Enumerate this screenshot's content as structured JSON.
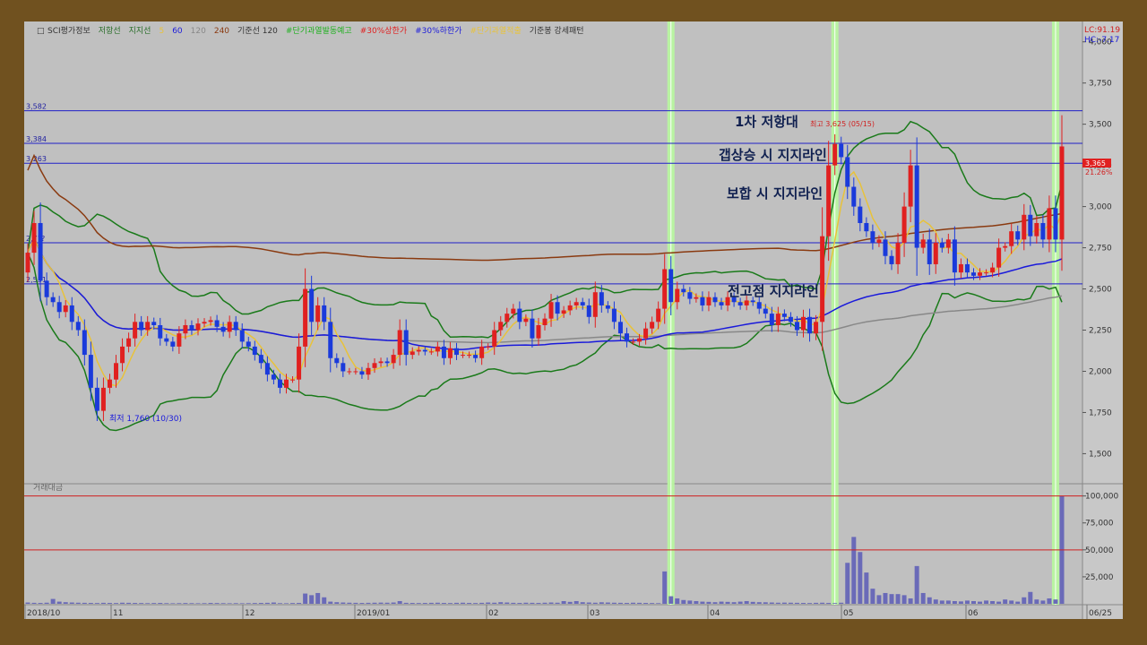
{
  "legend": {
    "items": [
      {
        "label": "SCI평가정보",
        "color": "#333333"
      },
      {
        "label": "저항선",
        "color": "#2a6e2a"
      },
      {
        "label": "지지선",
        "color": "#2a6e2a"
      },
      {
        "label": "5",
        "color": "#e8c23a"
      },
      {
        "label": "60",
        "color": "#1a1adb"
      },
      {
        "label": "120",
        "color": "#888888"
      },
      {
        "label": "240",
        "color": "#8a3a10"
      },
      {
        "label": "기준선 120",
        "color": "#333333"
      },
      {
        "label": "#단기과열발동예고",
        "color": "#20b020"
      },
      {
        "label": "#30%상한가",
        "color": "#e02020"
      },
      {
        "label": "#30%하한가",
        "color": "#1a1adb"
      },
      {
        "label": "#단기과열적출",
        "color": "#e8c23a"
      },
      {
        "label": "기준봉 강세패턴",
        "color": "#333333"
      }
    ]
  },
  "top_right": {
    "lc": "LC:91.19",
    "hc": "HC:-7.17"
  },
  "price_tag": {
    "value": "3,365",
    "change": "21.26%"
  },
  "volume_label": "거래대금",
  "annotations": {
    "resistance1": "1차 저항대",
    "gap_support": "갭상승 시 지지라인",
    "box_support": "보합 시 지지라인",
    "prev_high_support": "전고점 지지라인",
    "high_label": "최고 3,625 (05/15)",
    "low_label": "최저 1,760 (10/30)"
  },
  "chart_data": {
    "type": "candlestick",
    "price_axis": {
      "ylim": [
        1350,
        4080
      ],
      "ticks": [
        "4,000",
        "3,750",
        "3,500",
        "3,250",
        "3,000",
        "2,750",
        "2,500",
        "2,250",
        "2,000",
        "1,750",
        "1,500"
      ],
      "tick_values": [
        4000,
        3750,
        3500,
        3250,
        3000,
        2750,
        2500,
        2250,
        2000,
        1750,
        1500
      ]
    },
    "volume_axis": {
      "ylim": [
        0,
        108000
      ],
      "ticks": [
        "100,000",
        "75,000",
        "50,000",
        "25,000"
      ],
      "tick_values": [
        100000,
        75000,
        50000,
        25000
      ]
    },
    "x_labels": [
      "2018/10",
      "11",
      "12",
      "2019/01",
      "02",
      "03",
      "04",
      "05",
      "06",
      "06/25"
    ],
    "horizontal_levels": [
      {
        "label": "3,582",
        "value": 3582
      },
      {
        "label": "3,384",
        "value": 3384
      },
      {
        "label": "3,263",
        "value": 3263
      },
      {
        "label": "2,7??",
        "value": 2780
      },
      {
        "label": "2,531",
        "value": 2531
      }
    ],
    "candle_series": {
      "open": [
        2600,
        2720,
        2900,
        2550,
        2450,
        2420,
        2360,
        2400,
        2300,
        2250,
        2100,
        1900,
        1760,
        1900,
        1950,
        2050,
        2150,
        2200,
        2300,
        2250,
        2300,
        2280,
        2200,
        2180,
        2150,
        2230,
        2280,
        2250,
        2290,
        2300,
        2310,
        2270,
        2240,
        2300,
        2250,
        2180,
        2150,
        2100,
        2050,
        1980,
        1950,
        1900,
        1950,
        1950,
        2150,
        2500,
        2300,
        2400,
        2300,
        2080,
        2050,
        2000,
        2000,
        2000,
        1980,
        2020,
        2050,
        2060,
        2050,
        2100,
        2250,
        2100,
        2120,
        2130,
        2120,
        2120,
        2150,
        2080,
        2140,
        2100,
        2100,
        2100,
        2080,
        2150,
        2150,
        2250,
        2300,
        2350,
        2380,
        2300,
        2320,
        2200,
        2280,
        2320,
        2420,
        2350,
        2370,
        2400,
        2420,
        2400,
        2330,
        2480,
        2400,
        2380,
        2300,
        2230,
        2180,
        2180,
        2200,
        2260,
        2300,
        2380,
        2620,
        2420,
        2500,
        2480,
        2440,
        2450,
        2400,
        2450,
        2420,
        2400,
        2450,
        2420,
        2400,
        2430,
        2420,
        2380,
        2350,
        2280,
        2350,
        2330,
        2300,
        2250,
        2330,
        2230,
        2300,
        2820,
        3250,
        3380,
        3300,
        3120,
        3000,
        2900,
        2850,
        2780,
        2800,
        2700,
        2650,
        2780,
        3000,
        3250,
        2750,
        2800,
        2650,
        2780,
        2750,
        2800,
        2600,
        2650,
        2600,
        2580,
        2600,
        2600,
        2630,
        2750,
        2760,
        2850,
        2800,
        2950,
        2820,
        2900,
        2800,
        2990,
        2800
      ],
      "close": [
        2720,
        2900,
        2550,
        2450,
        2420,
        2360,
        2400,
        2300,
        2250,
        2100,
        1900,
        1760,
        1900,
        1950,
        2050,
        2150,
        2200,
        2300,
        2250,
        2300,
        2280,
        2200,
        2180,
        2150,
        2230,
        2280,
        2250,
        2290,
        2300,
        2310,
        2270,
        2240,
        2300,
        2250,
        2180,
        2150,
        2100,
        2050,
        1980,
        1950,
        1900,
        1950,
        1950,
        2150,
        2500,
        2300,
        2400,
        2300,
        2080,
        2050,
        2000,
        2000,
        2000,
        1980,
        2020,
        2050,
        2060,
        2050,
        2100,
        2250,
        2100,
        2120,
        2130,
        2120,
        2120,
        2150,
        2080,
        2140,
        2100,
        2100,
        2100,
        2080,
        2150,
        2150,
        2250,
        2300,
        2350,
        2380,
        2300,
        2320,
        2200,
        2280,
        2320,
        2420,
        2350,
        2370,
        2400,
        2420,
        2400,
        2330,
        2480,
        2400,
        2380,
        2300,
        2230,
        2180,
        2180,
        2200,
        2260,
        2300,
        2380,
        2620,
        2420,
        2500,
        2480,
        2440,
        2450,
        2400,
        2450,
        2420,
        2400,
        2450,
        2420,
        2400,
        2430,
        2420,
        2380,
        2350,
        2280,
        2350,
        2330,
        2300,
        2250,
        2330,
        2230,
        2300,
        2820,
        3250,
        3380,
        3300,
        3120,
        3000,
        2900,
        2850,
        2780,
        2800,
        2700,
        2650,
        2780,
        3000,
        3250,
        2750,
        2800,
        2650,
        2780,
        2750,
        2800,
        2600,
        2650,
        2600,
        2580,
        2600,
        2600,
        2630,
        2750,
        2760,
        2850,
        2800,
        2950,
        2820,
        2900,
        2800,
        2990,
        2800,
        3365
      ]
    },
    "volume_series": [
      1200,
      900,
      800,
      1000,
      4500,
      2000,
      1500,
      1200,
      1000,
      900,
      800,
      700,
      900,
      800,
      700,
      1000,
      900,
      800,
      700,
      600,
      700,
      800,
      600,
      500,
      600,
      700,
      600,
      500,
      600,
      800,
      700,
      600,
      500,
      600,
      500,
      600,
      700,
      800,
      900,
      1200,
      600,
      500,
      700,
      800,
      9500,
      8000,
      10000,
      6000,
      2000,
      1500,
      1200,
      1000,
      900,
      800,
      900,
      1000,
      1100,
      1000,
      1200,
      2500,
      900,
      800,
      700,
      800,
      900,
      1000,
      800,
      700,
      900,
      1000,
      800,
      700,
      900,
      1200,
      1000,
      1500,
      1200,
      900,
      800,
      1000,
      900,
      800,
      1000,
      1200,
      1000,
      2500,
      1800,
      2500,
      1500,
      1200,
      1000,
      1400,
      1200,
      1000,
      900,
      800,
      1000,
      900,
      800,
      700,
      600,
      30000,
      7000,
      5000,
      3500,
      3000,
      2500,
      2000,
      1800,
      1500,
      2000,
      1800,
      1500,
      2000,
      2500,
      1800,
      1500,
      1400,
      1200,
      1000,
      1100,
      1000,
      900,
      800,
      700,
      900,
      1000,
      800,
      700,
      1000,
      38000,
      62000,
      48000,
      29000,
      14000,
      8000,
      10000,
      9000,
      9000,
      8000,
      5000,
      35000,
      10000,
      6000,
      4000,
      3000,
      3000,
      2500,
      2200,
      3000,
      2500,
      2000,
      3000,
      2500,
      2000,
      4000,
      3000,
      2000,
      6000,
      11000,
      4000,
      3000,
      5000,
      4000,
      100000
    ],
    "spike_markers_index": [
      102,
      128,
      163
    ],
    "title": "",
    "xlabel": "",
    "ylabel": ""
  }
}
